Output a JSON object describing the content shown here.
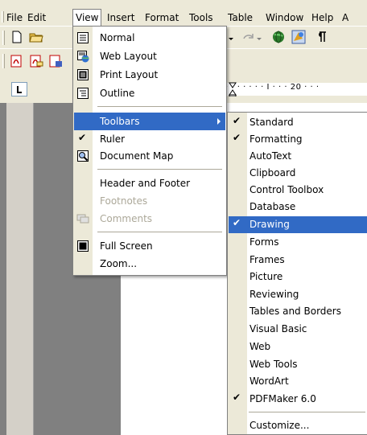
{
  "menubar": {
    "items": [
      {
        "label": "File"
      },
      {
        "label": "Edit"
      },
      {
        "label": "View"
      },
      {
        "label": "Insert"
      },
      {
        "label": "Format"
      },
      {
        "label": "Tools"
      },
      {
        "label": "Table"
      },
      {
        "label": "Window"
      },
      {
        "label": "Help"
      },
      {
        "label": "A"
      }
    ]
  },
  "ruler": {
    "text": "· · ·  ·  ·  ·  ·  I  ·  ·  ·  20 ·  ·  ·"
  },
  "view_menu": {
    "items": [
      {
        "label": "Normal",
        "icon": "normal-view-icon"
      },
      {
        "label": "Web Layout",
        "icon": "web-layout-icon"
      },
      {
        "label": "Print Layout",
        "icon": "print-layout-icon"
      },
      {
        "label": "Outline",
        "icon": "outline-view-icon"
      },
      {
        "label": "Toolbars",
        "state": "highlighted",
        "submenu": true
      },
      {
        "label": "Ruler",
        "checked": true
      },
      {
        "label": "Document Map",
        "icon": "document-map-icon"
      },
      {
        "label": "Header and Footer"
      },
      {
        "label": "Footnotes",
        "disabled": true
      },
      {
        "label": "Comments",
        "disabled": true,
        "icon": "comments-icon"
      },
      {
        "label": "Full Screen",
        "icon": "full-screen-icon"
      },
      {
        "label": "Zoom..."
      }
    ]
  },
  "toolbars_submenu": {
    "items": [
      {
        "label": "Standard",
        "checked": true
      },
      {
        "label": "Formatting",
        "checked": true
      },
      {
        "label": "AutoText"
      },
      {
        "label": "Clipboard"
      },
      {
        "label": "Control Toolbox"
      },
      {
        "label": "Database"
      },
      {
        "label": "Drawing",
        "checked": true,
        "state": "highlighted"
      },
      {
        "label": "Forms"
      },
      {
        "label": "Frames"
      },
      {
        "label": "Picture"
      },
      {
        "label": "Reviewing"
      },
      {
        "label": "Tables and Borders"
      },
      {
        "label": "Visual Basic"
      },
      {
        "label": "Web"
      },
      {
        "label": "Web Tools"
      },
      {
        "label": "WordArt"
      },
      {
        "label": "PDFMaker 6.0",
        "checked": true
      },
      {
        "label": "Customize..."
      }
    ]
  },
  "colors": {
    "highlight": "#316ac5",
    "menu_face": "#ece9d8",
    "disabled_text": "#aca899"
  }
}
